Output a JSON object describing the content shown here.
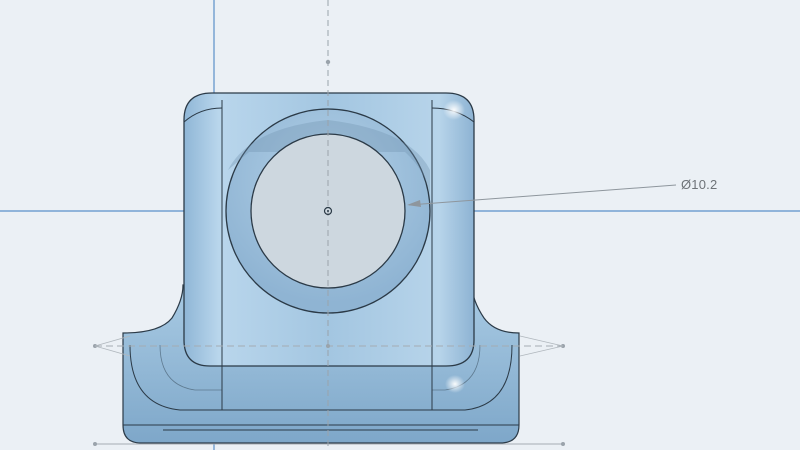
{
  "viewport": {
    "background": "#ebf0f5",
    "part_color": "#a7c9e2",
    "part_edge_color": "#2b3a47",
    "hole_color": "#cdd7df",
    "construction_line_color": "#5a8fc9",
    "sketch_line_color": "#9aa3ab"
  },
  "dimension": {
    "label": "Ø10.2"
  }
}
